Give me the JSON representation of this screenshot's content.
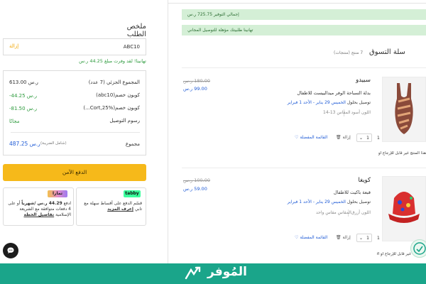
{
  "summary": {
    "title": "ملخص الطلب",
    "coupon_code": "ABC10",
    "coupon_remove": "إزالة",
    "coupon_saved": "تهانينا! لقد وفرت مبلغ 44.25 ر.س",
    "subtotal_label": "المجموع الجزئي (7 عدد)",
    "subtotal_value": "613.00 ر.س",
    "discount1_label": "كوبون خصم(abc10)",
    "discount1_value": "-44.25 ر.س",
    "discount2_label": "كوبون خصم(Cort,25%...)",
    "discount2_value": "-81.50 ر.س",
    "shipping_label": "رسوم التوصيل",
    "shipping_value": "مجانًا",
    "total_label": "مجموع",
    "total_note": "(شامل الضريبة)",
    "total_value": "487.25 ر.س",
    "checkout_label": "الدفع الآمن",
    "tabby_logo": "tabby",
    "tabby_text_1": "قسّم الدفع على أقساط سهلة مع تابي",
    "tabby_link": "إعرف المزيد",
    "tamara_logo": "تمارا",
    "tamara_text_1": "ادفع",
    "tamara_amount": "44.29 ر.س /شهرياً",
    "tamara_text_2": "أو على 4 دفعات متوافقة مع الشريعة الإسلامية",
    "tamara_link": "تفاصيل الخطة"
  },
  "banners": {
    "savings": "إجمالي التوفير 725.75 ر.س",
    "free_delivery": "تهانينا طلبيتك مؤهلة للتوصيل المجاني"
  },
  "cart": {
    "title": "سلة التسوق",
    "count": "7 منتج (منتجات)",
    "items": [
      {
        "name": "سبيدو",
        "description": "بدلة السباحة الوفر ميدالييست للاطفال",
        "delivery_prefix": "توصيل بحلول",
        "delivery_dates": "الخميس 29 يناير - الأحد 1 فبراير",
        "color": "اللون أسود",
        "size": "المقاس 13-14",
        "old_price": "180.00 ر.س",
        "new_price": "99.00 ر.س",
        "wishlist": "القائمة المفضلة",
        "remove": "إزالة",
        "qty": "1",
        "small_qty": "1",
        "non_returnable": "هذا المنتج غير قابل للإرجاع أو الاستبدال",
        "colors": {
          "primary": "#8a4a3a",
          "accent": "#e2a477"
        }
      },
      {
        "name": "كويغا",
        "description": "قبعة باكيت للاطفال",
        "delivery_prefix": "توصيل بحلول",
        "delivery_dates": "الخميس 29 يناير - الأحد 1 فبراير",
        "color": "اللون أزرق",
        "size": "المقاس مقاس واحد",
        "old_price": "100.00 ر.س",
        "new_price": "59.00 ر.س",
        "wishlist": "القائمة المفضلة",
        "remove": "إزالة",
        "qty": "1",
        "small_qty": "1",
        "non_returnable": "غير قابل للإرجاع أو الاستبدال",
        "colors": {
          "primary": "#d92f2f",
          "accent": "#2a4bd8"
        }
      }
    ]
  },
  "footer": {
    "brand": "المُوفر",
    "color": "#1aa58a"
  },
  "icons": {
    "chat": "chat-bubble-icon",
    "heart": "heart-icon",
    "trash": "trash-icon",
    "chevron": "chevron-down-icon",
    "floating": "app-badge-icon"
  }
}
